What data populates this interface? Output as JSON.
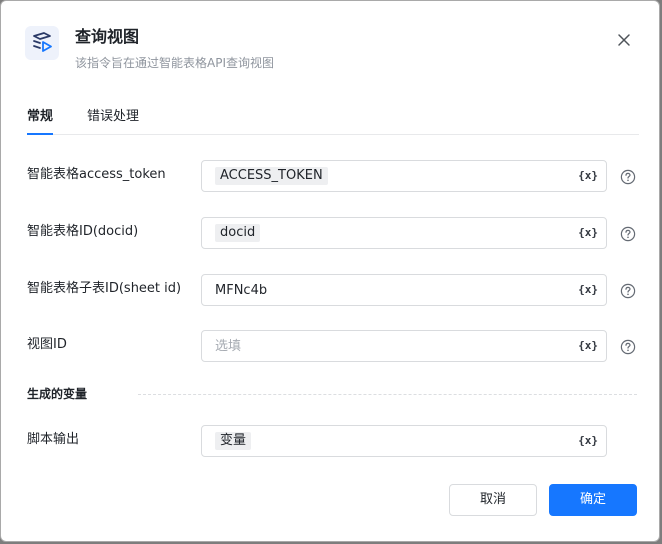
{
  "dialog": {
    "title": "查询视图",
    "subtitle": "该指令旨在通过智能表格API查询视图",
    "icon": "smart-sheet-view-icon"
  },
  "tabs": [
    {
      "label": "常规",
      "active": true
    },
    {
      "label": "错误处理",
      "active": false
    }
  ],
  "fields": [
    {
      "label": "智能表格access_token",
      "value": "ACCESS_TOKEN",
      "style": "chip"
    },
    {
      "label": "智能表格ID(docid)",
      "value": "docid",
      "style": "chip"
    },
    {
      "label": "智能表格子表ID(sheet id)",
      "value": "MFNc4b",
      "style": "plain"
    },
    {
      "label": "视图ID",
      "placeholder": "选填",
      "style": "placeholder"
    }
  ],
  "variable_button_label": "{x}",
  "output_section": {
    "title": "生成的变量",
    "field": {
      "label": "脚本输出",
      "value": "变量"
    }
  },
  "buttons": {
    "cancel": "取消",
    "confirm": "确定"
  },
  "colors": {
    "primary": "#1677ff",
    "text": "#1f2329",
    "muted": "#8f959e"
  }
}
